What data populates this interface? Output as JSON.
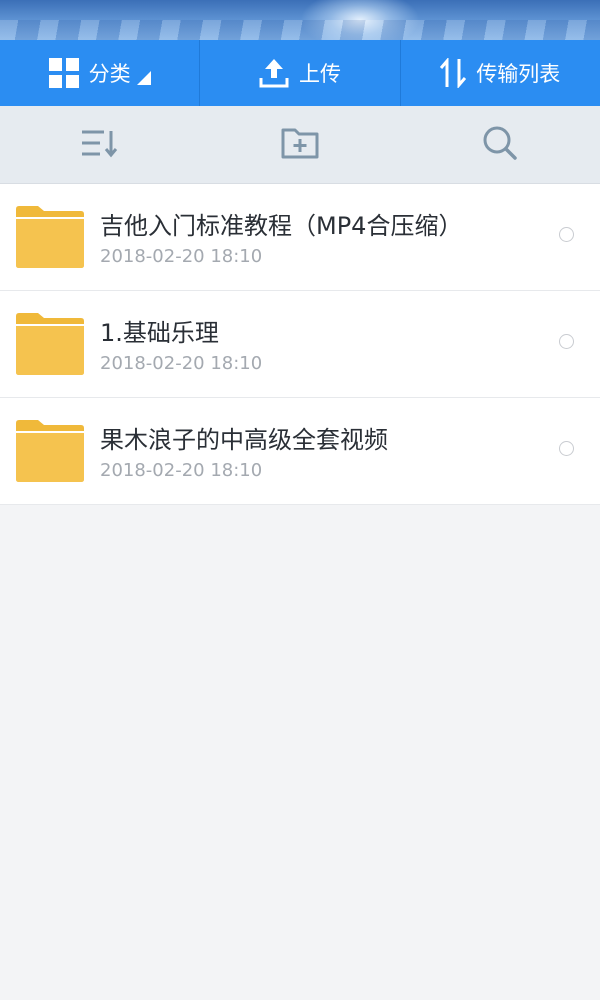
{
  "topbar": {
    "category_label": "分类",
    "upload_label": "上传",
    "transfer_label": "传输列表"
  },
  "toolbar": {
    "sort_icon": "sort-icon",
    "new_folder_icon": "new-folder-icon",
    "search_icon": "search-icon"
  },
  "files": [
    {
      "name": "吉他入门标准教程（MP4合压缩）",
      "date": "2018-02-20  18:10"
    },
    {
      "name": "1.基础乐理",
      "date": "2018-02-20  18:10"
    },
    {
      "name": "果木浪子的中高级全套视频",
      "date": "2018-02-20  18:10"
    }
  ],
  "colors": {
    "accent": "#2b8df2",
    "folder": "#f5c34f",
    "toolbar_bg": "#e6ebf0",
    "icon_gray": "#7e95a8"
  }
}
